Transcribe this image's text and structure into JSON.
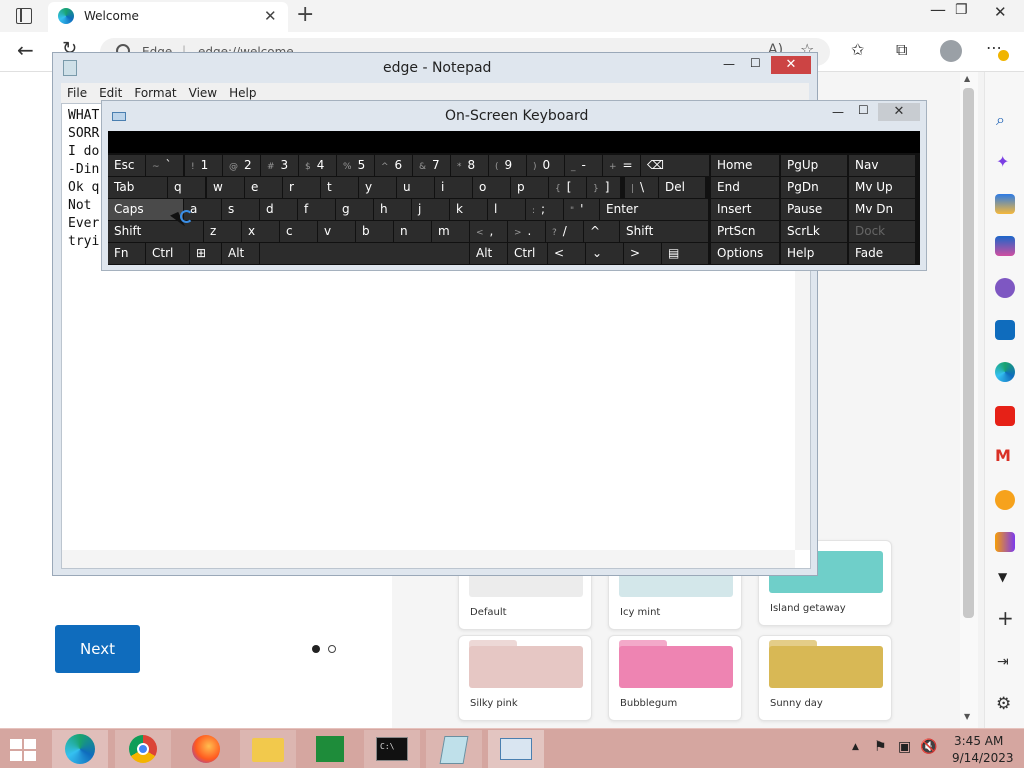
{
  "browser": {
    "tab_title": "Welcome",
    "address_prefix": "Edge",
    "address_url": "edge://welcome",
    "welcome": {
      "next_label": "Next",
      "themes": [
        {
          "name": "Default",
          "color": "#ececec"
        },
        {
          "name": "Icy mint",
          "color": "#d3e7ea"
        },
        {
          "name": "Island getaway",
          "color": "#6fcfc9"
        },
        {
          "name": "Silky pink",
          "color": "#e6c7c4"
        },
        {
          "name": "Bubblegum",
          "color": "#ee84b2"
        },
        {
          "name": "Sunny day",
          "color": "#d8b855"
        }
      ]
    }
  },
  "notepad": {
    "title": "edge - Notepad",
    "menu": [
      "File",
      "Edit",
      "Format",
      "View",
      "Help"
    ],
    "lines": [
      "WHAT",
      "SORR",
      "I do",
      "-Din",
      "Ok q",
      "Not ",
      "Ever",
      "tryi"
    ]
  },
  "osk": {
    "title": "On-Screen Keyboard",
    "rows": [
      [
        [
          "Esc",
          ""
        ],
        [
          "`",
          "~"
        ],
        [
          "1",
          "!"
        ],
        [
          "2",
          "@"
        ],
        [
          "3",
          "#"
        ],
        [
          "4",
          "$"
        ],
        [
          "5",
          "%"
        ],
        [
          "6",
          "^"
        ],
        [
          "7",
          "&"
        ],
        [
          "8",
          "*"
        ],
        [
          "9",
          "("
        ],
        [
          "0",
          ")"
        ],
        [
          "-",
          "_"
        ],
        [
          "=",
          "+"
        ],
        [
          "⌫",
          ""
        ],
        [
          "Home",
          ""
        ],
        [
          "PgUp",
          ""
        ],
        [
          "Nav",
          ""
        ]
      ],
      [
        [
          "Tab",
          ""
        ],
        [
          "q",
          ""
        ],
        [
          "w",
          ""
        ],
        [
          "e",
          ""
        ],
        [
          "r",
          ""
        ],
        [
          "t",
          ""
        ],
        [
          "y",
          ""
        ],
        [
          "u",
          ""
        ],
        [
          "i",
          ""
        ],
        [
          "o",
          ""
        ],
        [
          "p",
          ""
        ],
        [
          "[",
          "{"
        ],
        [
          "]",
          "}"
        ],
        [
          "\\",
          "|"
        ],
        [
          "Del",
          ""
        ],
        [
          "End",
          ""
        ],
        [
          "PgDn",
          ""
        ],
        [
          "Mv Up",
          ""
        ]
      ],
      [
        [
          "Caps",
          ""
        ],
        [
          "a",
          ""
        ],
        [
          "s",
          ""
        ],
        [
          "d",
          ""
        ],
        [
          "f",
          ""
        ],
        [
          "g",
          ""
        ],
        [
          "h",
          ""
        ],
        [
          "j",
          ""
        ],
        [
          "k",
          ""
        ],
        [
          "l",
          ""
        ],
        [
          ";",
          ":"
        ],
        [
          "'",
          "\""
        ],
        [
          "Enter",
          ""
        ],
        [
          "Insert",
          ""
        ],
        [
          "Pause",
          ""
        ],
        [
          "Mv Dn",
          ""
        ]
      ],
      [
        [
          "Shift",
          ""
        ],
        [
          "z",
          ""
        ],
        [
          "x",
          ""
        ],
        [
          "c",
          ""
        ],
        [
          "v",
          ""
        ],
        [
          "b",
          ""
        ],
        [
          "n",
          ""
        ],
        [
          "m",
          ""
        ],
        [
          ",",
          "<"
        ],
        [
          ".",
          ">"
        ],
        [
          "/",
          "?"
        ],
        [
          "^",
          ""
        ],
        [
          "Shift",
          ""
        ],
        [
          "PrtScn",
          ""
        ],
        [
          "ScrLk",
          ""
        ],
        [
          "Dock",
          ""
        ]
      ],
      [
        [
          "Fn",
          ""
        ],
        [
          "Ctrl",
          ""
        ],
        [
          "⊞",
          ""
        ],
        [
          "Alt",
          ""
        ],
        [
          "",
          ""
        ],
        [
          "Alt",
          ""
        ],
        [
          "Ctrl",
          ""
        ],
        [
          "<",
          ""
        ],
        [
          "⌄",
          ""
        ],
        [
          ">",
          ""
        ],
        [
          "▤",
          ""
        ],
        [
          "Options",
          ""
        ],
        [
          "Help",
          ""
        ],
        [
          "Fade",
          ""
        ]
      ]
    ]
  },
  "taskbar": {
    "time": "3:45 AM",
    "date": "9/14/2023"
  },
  "colors": {
    "accent": "#0f6cbd",
    "taskbar": "#d5a6a0"
  }
}
